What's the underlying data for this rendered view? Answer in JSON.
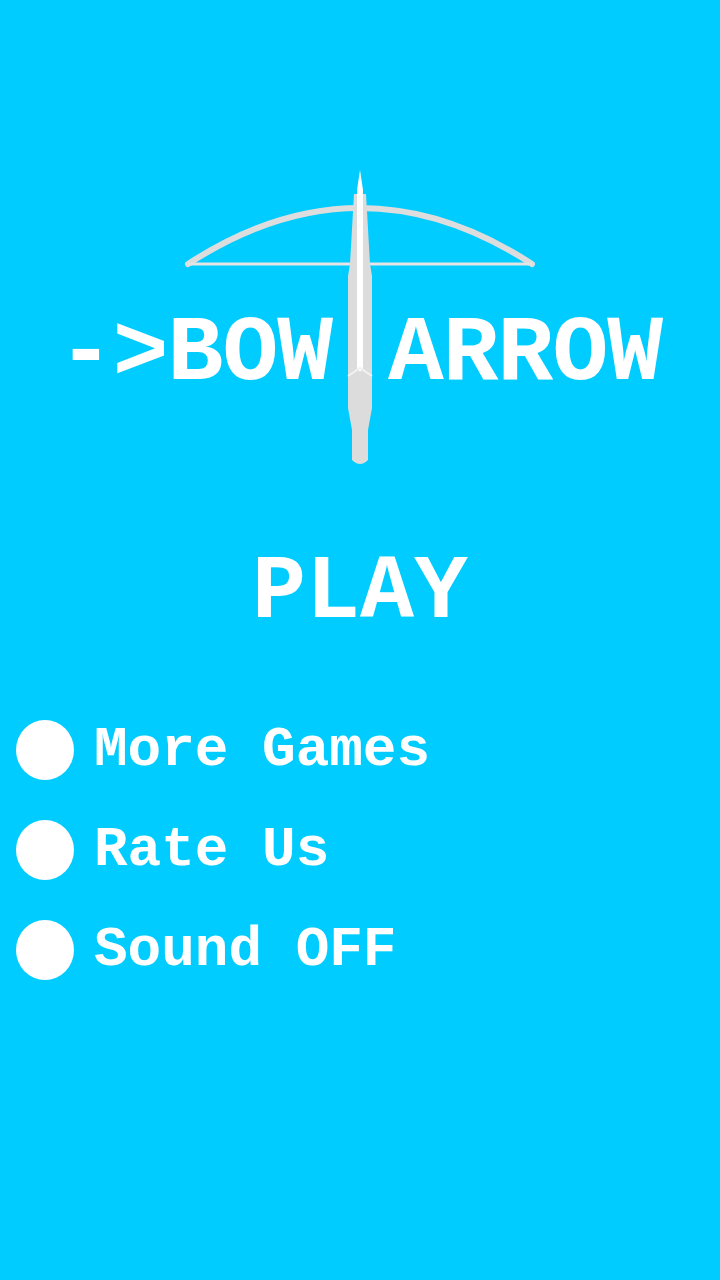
{
  "logo": {
    "left_text": "->BOW",
    "right_text": "ARROW"
  },
  "play_button": {
    "label": "PLAY"
  },
  "menu": [
    {
      "label": "More Games"
    },
    {
      "label": "Rate Us"
    },
    {
      "label": "Sound OFF"
    }
  ]
}
